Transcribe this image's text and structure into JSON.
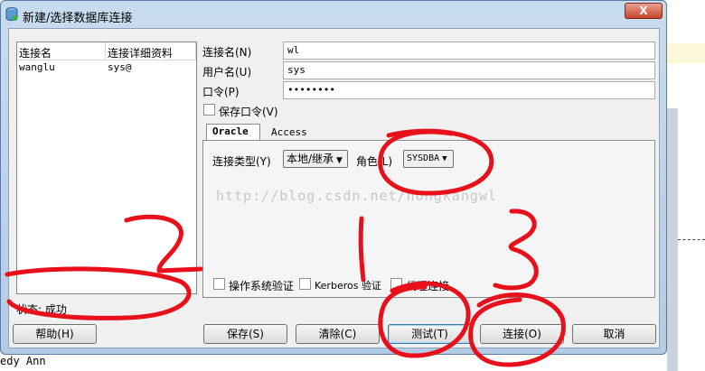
{
  "background": {
    "bottom_text": "edy Ann"
  },
  "window": {
    "title": "新建/选择数据库连接",
    "close_glyph": "X"
  },
  "connection_list": {
    "headers": [
      "连接名",
      "连接详细资料"
    ],
    "rows": [
      {
        "name": "wanglu",
        "details": "sys@"
      }
    ]
  },
  "form": {
    "conn_name_label": "连接名(N)",
    "conn_name_value": "wl",
    "user_label": "用户名(U)",
    "user_value": "sys",
    "password_label": "口令(P)",
    "password_value": "••••••••",
    "save_password_label": "保存口令(V)"
  },
  "tabs": [
    {
      "label": "Oracle",
      "active": true
    },
    {
      "label": "Access",
      "active": false
    }
  ],
  "oracle_tab": {
    "conn_type_label": "连接类型(Y)",
    "conn_type_value": "本地/继承",
    "role_label": "角色(L)",
    "role_value": "SYSDBA",
    "os_auth_label": "操作系统验证",
    "kerberos_label": "Kerberos 验证",
    "proxy_label": "代理连接"
  },
  "watermark": "http://blog.csdn.net/hongkangwl",
  "status": "状态: 成功",
  "buttons": {
    "help": "帮助(H)",
    "save": "保存(S)",
    "clear": "清除(C)",
    "test": "测试(T)",
    "connect": "连接(O)",
    "cancel": "取消"
  },
  "annotations": [
    "2",
    "1",
    "3"
  ],
  "colors": {
    "annotation_red": "#e8101a",
    "title_gradient_top": "#c9dcef",
    "close_red": "#c7452d"
  }
}
